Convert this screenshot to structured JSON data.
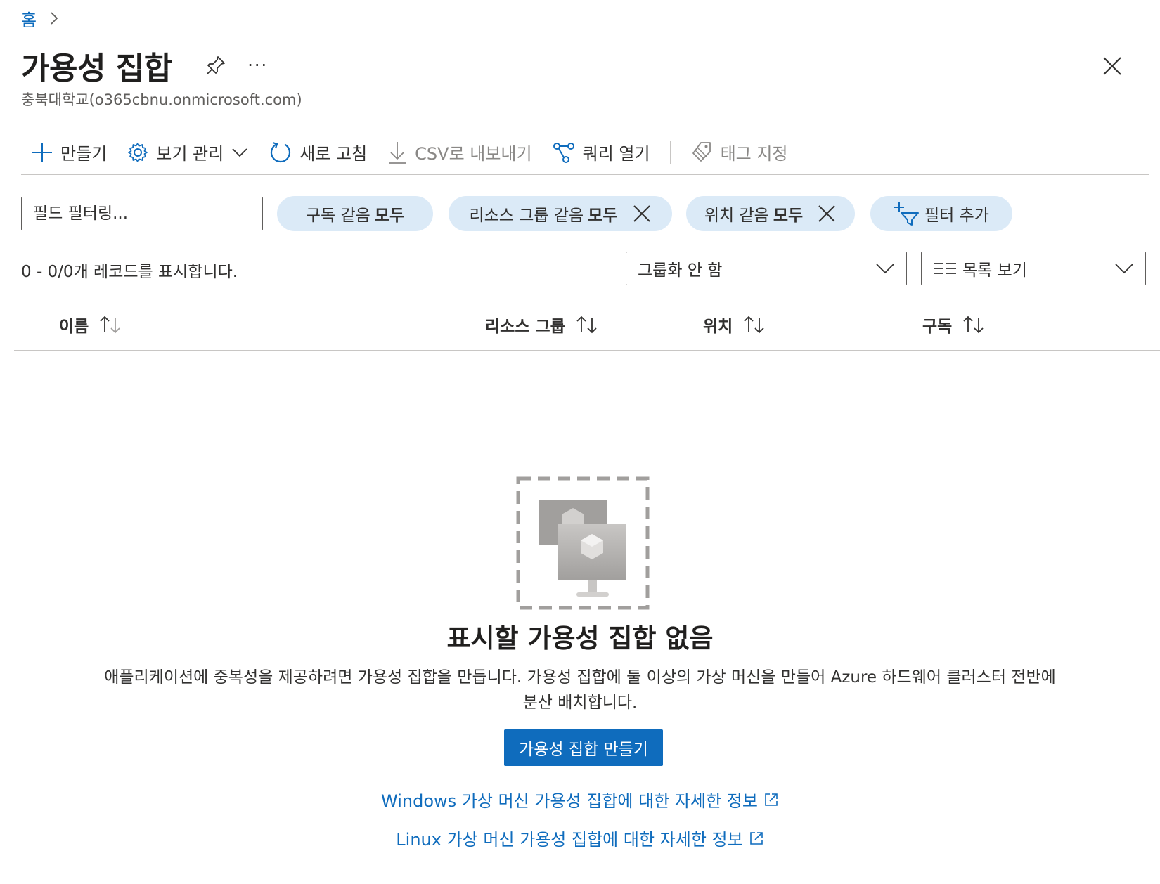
{
  "breadcrumb": {
    "home": "홈"
  },
  "header": {
    "title": "가용성 집합",
    "more": "···",
    "subtitle": "충북대학교(o365cbnu.onmicrosoft.com)"
  },
  "toolbar": {
    "create": "만들기",
    "manage_view": "보기 관리",
    "refresh": "새로 고침",
    "export_csv": "CSV로 내보내기",
    "open_query": "쿼리 열기",
    "assign_tags": "태그 지정"
  },
  "filters": {
    "search_placeholder": "필드 필터링...",
    "subscription": {
      "label": "구독 같음 ",
      "value": "모두"
    },
    "resource_group": {
      "label": "리소스 그룹 같음 ",
      "value": "모두"
    },
    "location": {
      "label": "위치 같음 ",
      "value": "모두"
    },
    "add_filter": "필터 추가"
  },
  "list": {
    "record_count": "0 - 0/0개 레코드를 표시합니다.",
    "grouping": "그룹화 안 함",
    "view": "목록 보기",
    "columns": [
      "이름",
      "리소스 그룹",
      "위치",
      "구독"
    ]
  },
  "empty_state": {
    "title": "표시할 가용성 집합 없음",
    "description": "애플리케이션에 중복성을 제공하려면 가용성 집합을 만듭니다. 가용성 집합에 둘 이상의 가상 머신을 만들어 Azure 하드웨어 클러스터 전반에 분산 배치합니다.",
    "create_button": "가용성 집합 만들기",
    "link_windows": "Windows 가상 머신 가용성 집합에 대한 자세한 정보",
    "link_linux": "Linux 가상 머신 가용성 집합에 대한 자세한 정보"
  },
  "colors": {
    "accent": "#0f6cbd",
    "pill_bg": "#dbeaf7",
    "text": "#323130",
    "disabled": "#8a8886"
  },
  "icons": [
    "chevron-right-icon",
    "pin-icon",
    "close-icon",
    "plus-icon",
    "gear-icon",
    "chevron-down-icon",
    "refresh-icon",
    "download-icon",
    "query-icon",
    "tag-icon",
    "filter-add-icon",
    "list-icon",
    "sort-icon",
    "external-link-icon",
    "availability-set-illustration"
  ]
}
